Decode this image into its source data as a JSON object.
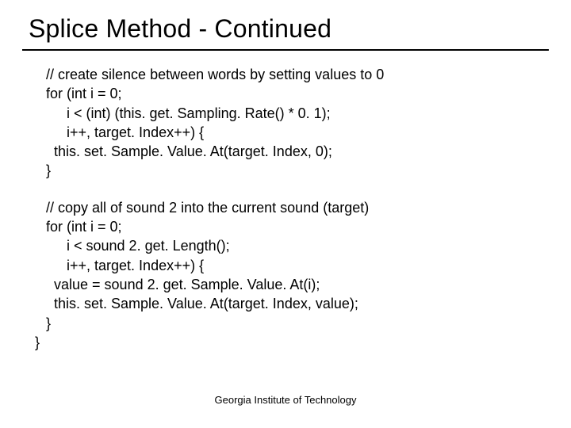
{
  "title": "Splice Method - Continued",
  "block1": {
    "l1": "// create silence between words by setting values to 0",
    "l2": "for (int i = 0;",
    "l3": "i < (int) (this. get. Sampling. Rate() * 0. 1);",
    "l4": "i++, target. Index++) {",
    "l5": "this. set. Sample. Value. At(target. Index, 0);",
    "l6": "}"
  },
  "block2": {
    "l1": "// copy all of sound 2 into the current sound (target)",
    "l2": "for (int i = 0;",
    "l3": "i < sound 2. get. Length();",
    "l4": "i++, target. Index++) {",
    "l5": "value = sound 2. get. Sample. Value. At(i);",
    "l6": "this. set. Sample. Value. At(target. Index, value);",
    "l7": "}",
    "l8": "}"
  },
  "footer": "Georgia Institute of Technology"
}
